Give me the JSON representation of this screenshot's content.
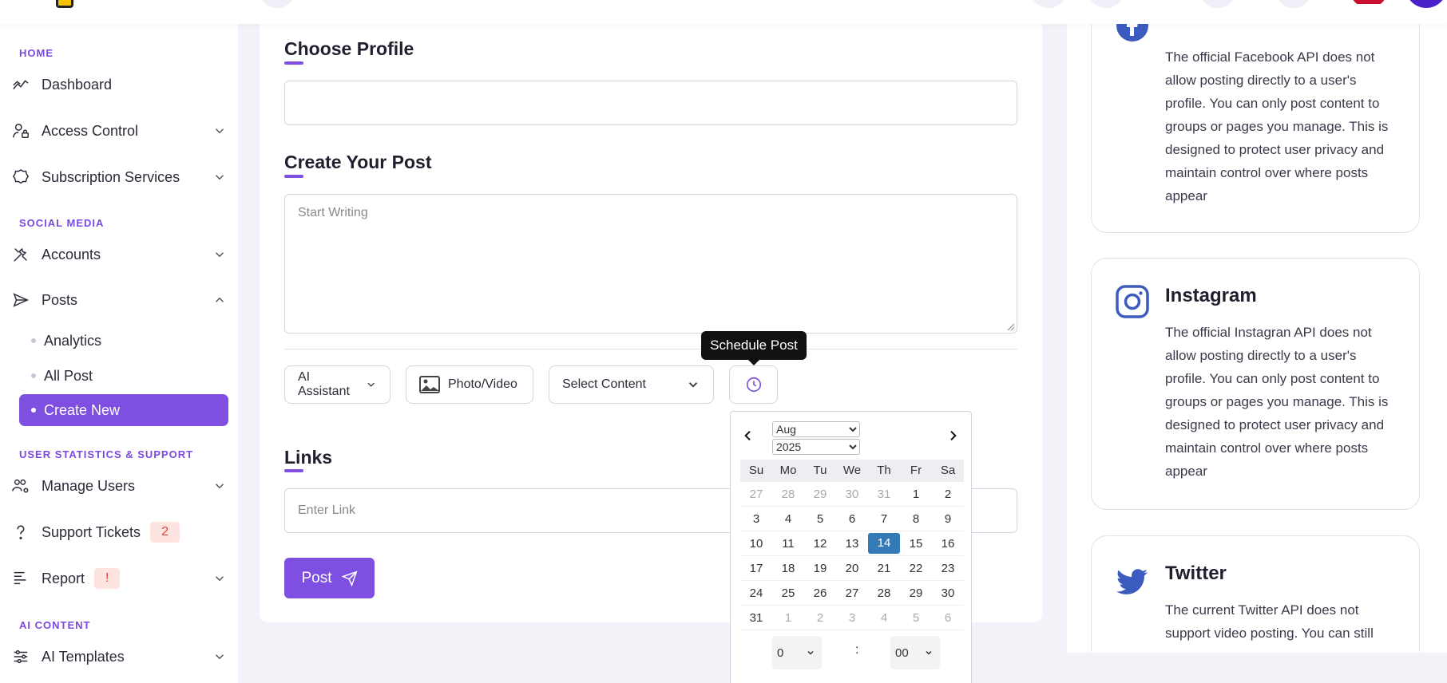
{
  "sidebar": {
    "sections": {
      "home": "HOME",
      "social_media": "SOCIAL MEDIA",
      "user_stats": "USER STATISTICS & SUPPORT",
      "ai_content": "AI CONTENT"
    },
    "items": {
      "dashboard": "Dashboard",
      "access_control": "Access Control",
      "subscription_services": "Subscription Services",
      "accounts": "Accounts",
      "posts": "Posts",
      "manage_users": "Manage Users",
      "support_tickets": "Support Tickets",
      "support_tickets_badge": "2",
      "report": "Report",
      "report_badge": "!",
      "ai_templates": "AI Templates"
    },
    "posts_sub": {
      "analytics": "Analytics",
      "all_post": "All Post",
      "create_new": "Create New"
    },
    "accent": "#7e4fe0"
  },
  "main": {
    "choose_profile_title": "Choose Profile",
    "create_post_title": "Create Your Post",
    "post_placeholder": "Start Writing",
    "ai_assistant_label": "AI Assistant",
    "photo_video_label": "Photo/Video",
    "select_content_label": "Select Content",
    "tooltip": "Schedule Post",
    "links_title": "Links",
    "link_placeholder": "Enter Link",
    "post_button": "Post"
  },
  "datepicker": {
    "month": "Aug",
    "year": "2025",
    "weekdays": [
      "Su",
      "Mo",
      "Tu",
      "We",
      "Th",
      "Fr",
      "Sa"
    ],
    "weeks": [
      [
        "27",
        "28",
        "29",
        "30",
        "31",
        "1",
        "2"
      ],
      [
        "3",
        "4",
        "5",
        "6",
        "7",
        "8",
        "9"
      ],
      [
        "10",
        "11",
        "12",
        "13",
        "14",
        "15",
        "16"
      ],
      [
        "17",
        "18",
        "19",
        "20",
        "21",
        "22",
        "23"
      ],
      [
        "24",
        "25",
        "26",
        "27",
        "28",
        "29",
        "30"
      ],
      [
        "31",
        "1",
        "2",
        "3",
        "4",
        "5",
        "6"
      ]
    ],
    "selected_day": "14",
    "hour": "0",
    "minute": "00",
    "time_separator": ":",
    "selected_color": "#337ab7"
  },
  "info_cards": {
    "facebook": {
      "text": "The official Facebook API does not allow posting directly to a user's profile. You can only post content to groups or pages you manage. This is designed to protect user privacy and maintain control over where posts appear"
    },
    "instagram": {
      "title": "Instagram",
      "text": "The official Instagran API does not allow posting directly to a user's profile. You can only post content to groups or pages you manage. This is designed to protect user privacy and maintain control over where posts appear"
    },
    "twitter": {
      "title": "Twitter",
      "text": "The current Twitter API does not support video posting. You can still"
    },
    "icon_color": "#3b5bbf"
  }
}
